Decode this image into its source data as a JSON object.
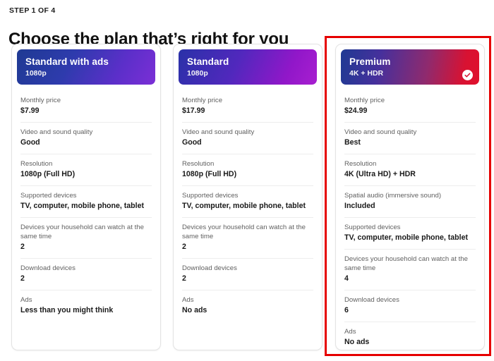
{
  "header": {
    "step_label": "STEP 1 OF 4",
    "title": "Choose the plan that’s right for you"
  },
  "colors": {
    "selection_border": "#e60000",
    "label_text": "#616161",
    "value_text": "#1a1a1a",
    "divider": "#ededed",
    "card_border": "#e3e3e3"
  },
  "plans": [
    {
      "name": "Standard with ads",
      "quality": "1080p",
      "selected": false,
      "features": [
        {
          "label": "Monthly price",
          "value": "$7.99"
        },
        {
          "label": "Video and sound quality",
          "value": "Good"
        },
        {
          "label": "Resolution",
          "value": "1080p (Full HD)"
        },
        {
          "label": "Supported devices",
          "value": "TV, computer, mobile phone, tablet"
        },
        {
          "label": "Devices your household can watch at the same time",
          "value": "2"
        },
        {
          "label": "Download devices",
          "value": "2"
        },
        {
          "label": "Ads",
          "value": "Less than you might think"
        }
      ]
    },
    {
      "name": "Standard",
      "quality": "1080p",
      "selected": false,
      "features": [
        {
          "label": "Monthly price",
          "value": "$17.99"
        },
        {
          "label": "Video and sound quality",
          "value": "Good"
        },
        {
          "label": "Resolution",
          "value": "1080p (Full HD)"
        },
        {
          "label": "Supported devices",
          "value": "TV, computer, mobile phone, tablet"
        },
        {
          "label": "Devices your household can watch at the same time",
          "value": "2"
        },
        {
          "label": "Download devices",
          "value": "2"
        },
        {
          "label": "Ads",
          "value": "No ads"
        }
      ]
    },
    {
      "name": "Premium",
      "quality": "4K + HDR",
      "selected": true,
      "features": [
        {
          "label": "Monthly price",
          "value": "$24.99"
        },
        {
          "label": "Video and sound quality",
          "value": "Best"
        },
        {
          "label": "Resolution",
          "value": "4K (Ultra HD) + HDR"
        },
        {
          "label": "Spatial audio (immersive sound)",
          "value": "Included"
        },
        {
          "label": "Supported devices",
          "value": "TV, computer, mobile phone, tablet"
        },
        {
          "label": "Devices your household can watch at the same time",
          "value": "4"
        },
        {
          "label": "Download devices",
          "value": "6"
        },
        {
          "label": "Ads",
          "value": "No ads"
        }
      ]
    }
  ]
}
